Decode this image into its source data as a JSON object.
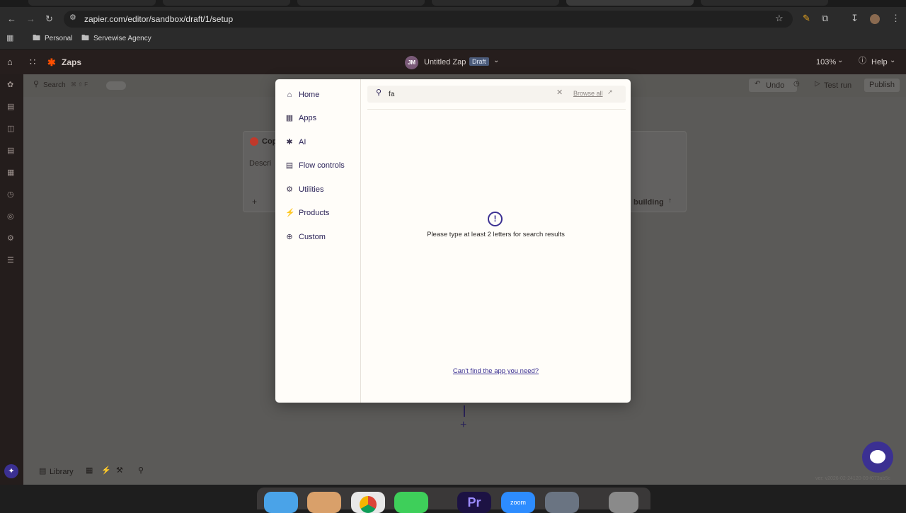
{
  "browser": {
    "url": "zapier.com/editor/sandbox/draft/1/setup",
    "bookmarks": [
      "Personal",
      "Servewise Agency"
    ]
  },
  "header": {
    "app_name": "Zaps",
    "avatar_initials": "JM",
    "zap_title": "Untitled Zap",
    "status_badge": "Draft",
    "zoom": "103%",
    "help": "Help"
  },
  "subbar": {
    "search_label": "Search",
    "shortcut": "⌘ ⇧ F",
    "undo": "Undo",
    "test_run": "Test run",
    "publish": "Publish"
  },
  "background_card": {
    "title_fragment": "Cop",
    "description_fragment": "Descri",
    "building_label": "building"
  },
  "modal": {
    "nav": [
      {
        "label": "Home",
        "icon": "home-icon"
      },
      {
        "label": "Apps",
        "icon": "apps-icon"
      },
      {
        "label": "AI",
        "icon": "ai-icon"
      },
      {
        "label": "Flow controls",
        "icon": "flow-controls-icon"
      },
      {
        "label": "Utilities",
        "icon": "utilities-icon"
      },
      {
        "label": "Products",
        "icon": "products-icon"
      },
      {
        "label": "Custom",
        "icon": "custom-icon"
      }
    ],
    "search_value": "fa",
    "browse_all": "Browse all",
    "empty_message": "Please type at least 2 letters for search results",
    "cant_find_link": "Can't find the app you need?"
  },
  "bottom_toolbar": {
    "library": "Library"
  },
  "version": "ver: v2026-02-24120-09-f073ab5c",
  "colors": {
    "brand_orange": "#ff4f00",
    "accent_purple": "#3b3092",
    "badge_bg": "#4b5b7a"
  }
}
